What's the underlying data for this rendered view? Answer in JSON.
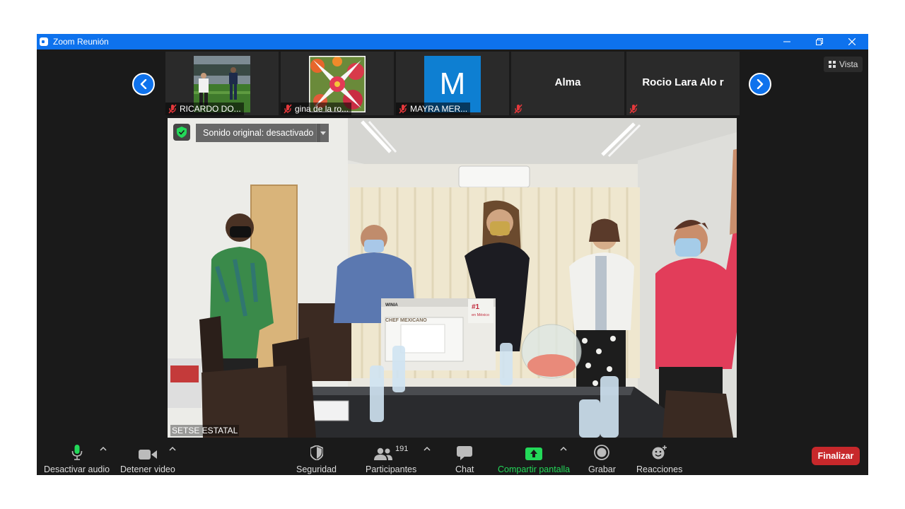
{
  "window": {
    "title": "Zoom Reunión"
  },
  "gallery_strip": {
    "participants": [
      {
        "name": "RICARDO DO...",
        "muted": true,
        "kind": "photo-soccer"
      },
      {
        "name": "gina de la ro...",
        "muted": true,
        "kind": "photo-flowers"
      },
      {
        "name": "MAYRA MER...",
        "muted": true,
        "kind": "initial",
        "initial": "M",
        "color": "#0e7fd2"
      },
      {
        "name": "Alma",
        "muted": true,
        "kind": "name-only"
      },
      {
        "name": "Rocio Lara Alo r",
        "muted": true,
        "kind": "name-only"
      }
    ]
  },
  "view_button": {
    "label": "Vista"
  },
  "main_video": {
    "speaker": "SETSE ESTATAL",
    "original_sound": "Sonido original: desactivado",
    "box_brand": "WINIA",
    "box_title": "CHEF MEXICANO",
    "box_badge_1": "#1",
    "box_badge_2": "en México"
  },
  "toolbar": {
    "audio": "Desactivar audio",
    "video": "Detener video",
    "security": "Seguridad",
    "participants": "Participantes",
    "participants_count": "191",
    "chat": "Chat",
    "share": "Compartir pantalla",
    "record": "Grabar",
    "reactions": "Reacciones",
    "end": "Finalizar"
  }
}
